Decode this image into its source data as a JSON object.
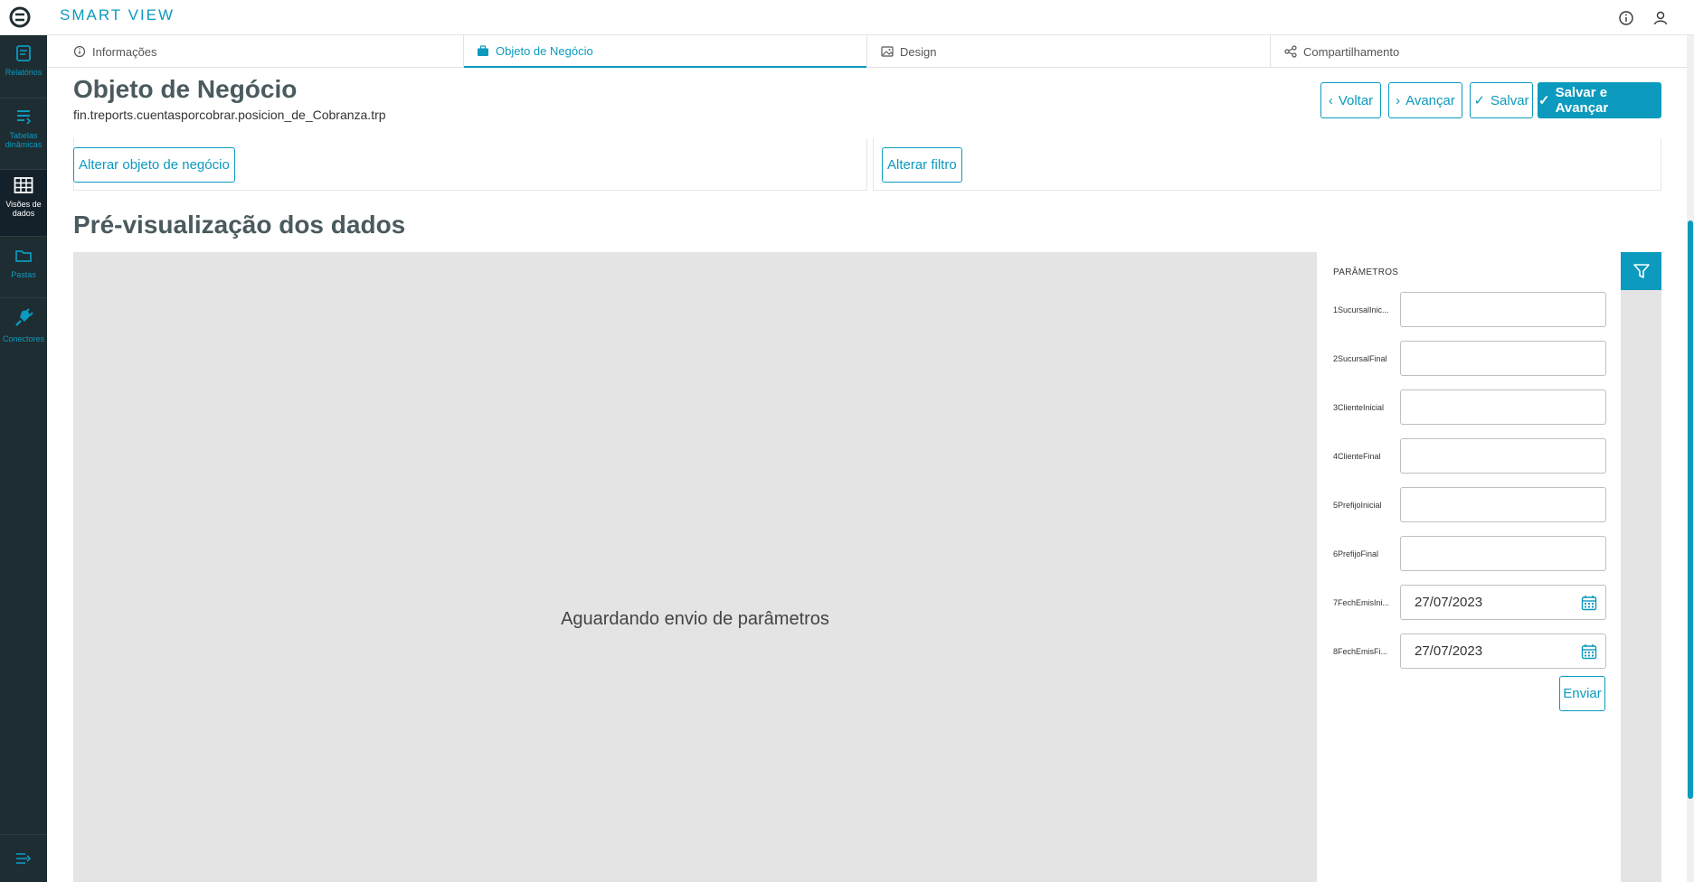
{
  "app": {
    "brand": "SMART VIEW"
  },
  "sidebar": {
    "items": [
      {
        "label": "Relatórios",
        "icon": "report-icon"
      },
      {
        "label": "Tabelas dinâmicas",
        "icon": "pivot-table-icon"
      },
      {
        "label": "Visões de dados",
        "icon": "grid-icon",
        "active": true
      },
      {
        "label": "Pastas",
        "icon": "folder-icon"
      },
      {
        "label": "Conectores",
        "icon": "plug-icon"
      }
    ],
    "collapse_icon": "collapse-menu-icon"
  },
  "tabs": [
    {
      "label": "Informações",
      "icon": "info-icon"
    },
    {
      "label": "Objeto de Negócio",
      "icon": "briefcase-icon",
      "active": true
    },
    {
      "label": "Design",
      "icon": "image-icon"
    },
    {
      "label": "Compartilhamento",
      "icon": "share-icon"
    }
  ],
  "header": {
    "title": "Objeto de Negócio",
    "object_name": "fin.treports.cuentasporcobrar.posicion_de_Cobranza.trp",
    "buttons": {
      "back": "Voltar",
      "next": "Avançar",
      "save": "Salvar",
      "save_next": "Salvar e Avançar"
    }
  },
  "panels": {
    "change_object": "Alterar objeto de negócio",
    "change_filter": "Alterar filtro"
  },
  "preview": {
    "title": "Pré-visualização dos dados",
    "message": "Aguardando envio de parâmetros"
  },
  "params": {
    "title": "PARÂMETROS",
    "fields": [
      {
        "label": "1SucursalInic...",
        "value": ""
      },
      {
        "label": "2SucursalFinal",
        "value": ""
      },
      {
        "label": "3ClienteInicial",
        "value": ""
      },
      {
        "label": "4ClienteFinal",
        "value": ""
      },
      {
        "label": "5PrefijoInicial",
        "value": ""
      },
      {
        "label": "6PrefijoFinal",
        "value": ""
      },
      {
        "label": "7FechEmisIni...",
        "value": "27/07/2023"
      },
      {
        "label": "8FechEmisFi...",
        "value": "27/07/2023"
      }
    ],
    "submit": "Enviar"
  },
  "colors": {
    "accent": "#0c9abe",
    "sidebar_bg": "#1e2d32",
    "preview_bg": "#e4e4e4"
  }
}
